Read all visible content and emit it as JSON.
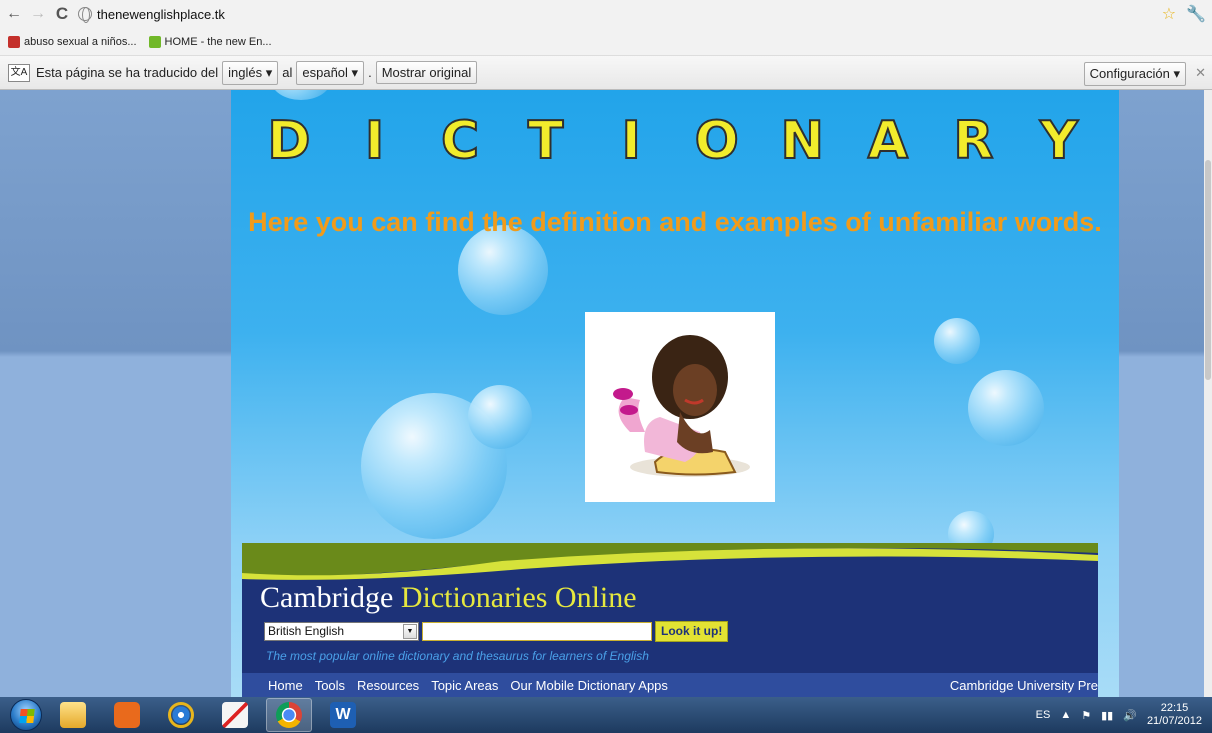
{
  "browser": {
    "url": "thenewenglishplace.tk",
    "bookmarks": [
      "abuso sexual a niños...",
      "HOME - the new En..."
    ]
  },
  "translate_bar": {
    "prefix": "Esta página se ha traducido del",
    "from_lang": "inglés",
    "conj": "al",
    "to_lang": "español",
    "period": ".",
    "show_original": "Mostrar original",
    "settings": "Configuración"
  },
  "page": {
    "banner_letters": [
      "D",
      "I",
      "C",
      "T",
      "I",
      "O",
      "N",
      "A",
      "R",
      "Y"
    ],
    "headline": "Here you can find the definition and examples of unfamiliar words."
  },
  "cambridge": {
    "title_main": "Cambridge",
    "title_accent": "Dictionaries Online",
    "select_value": "British English",
    "search_value": "",
    "button": "Look it up!",
    "tagline": "The most popular online dictionary and thesaurus for learners of English",
    "nav": [
      "Home",
      "Tools",
      "Resources",
      "Topic Areas",
      "Our Mobile Dictionary Apps"
    ],
    "nav_right": "Cambridge University Pre"
  },
  "taskbar": {
    "lang": "ES",
    "time": "22:15",
    "date": "21/07/2012",
    "apps": [
      "folder-icon",
      "media-player-icon",
      "ie-icon",
      "paint-icon",
      "chrome-icon",
      "word-icon"
    ]
  }
}
